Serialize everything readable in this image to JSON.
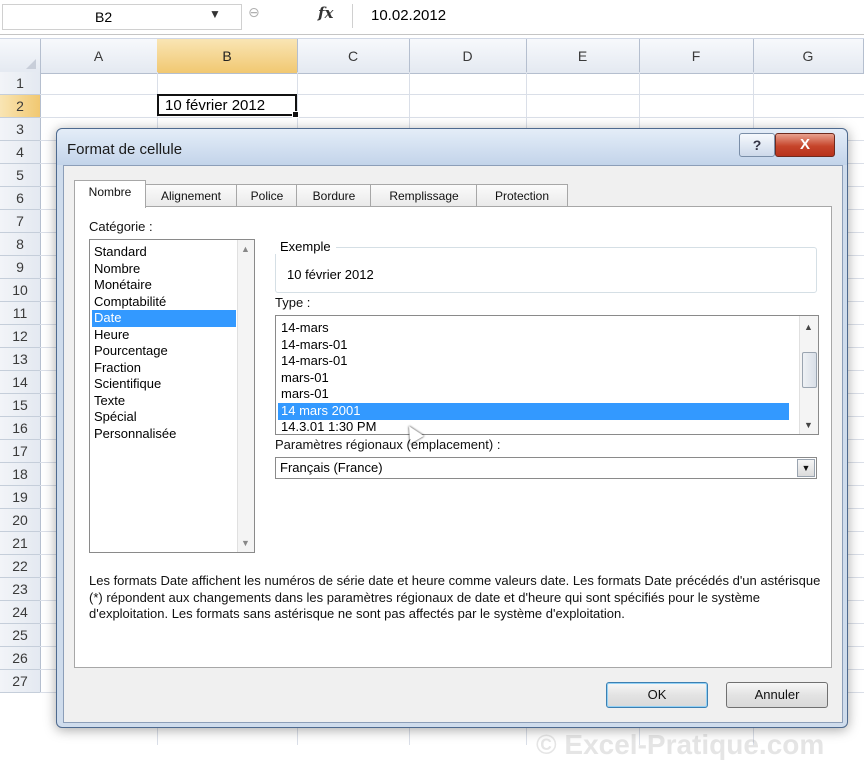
{
  "formula_bar": {
    "name_box": "B2",
    "cancel_glyph": "⊖",
    "fx_label": "fx",
    "formula": "10.02.2012"
  },
  "grid": {
    "columns": [
      "A",
      "B",
      "C",
      "D",
      "E",
      "F",
      "G"
    ],
    "rows": [
      "1",
      "2",
      "3",
      "4",
      "5",
      "6",
      "7",
      "8",
      "9",
      "10",
      "11",
      "12",
      "13",
      "14",
      "15",
      "16",
      "17",
      "18",
      "19",
      "20",
      "21",
      "22",
      "23",
      "24",
      "25",
      "26",
      "27"
    ],
    "selected_column": "B",
    "selected_row": "2",
    "cell_b2": "10 février 2012"
  },
  "dialog": {
    "title": "Format de cellule",
    "help_label": "?",
    "close_label": "X",
    "tabs": [
      "Nombre",
      "Alignement",
      "Police",
      "Bordure",
      "Remplissage",
      "Protection"
    ],
    "active_tab": "Nombre",
    "category_label": "Catégorie :",
    "categories": [
      "Standard",
      "Nombre",
      "Monétaire",
      "Comptabilité",
      "Date",
      "Heure",
      "Pourcentage",
      "Fraction",
      "Scientifique",
      "Texte",
      "Spécial",
      "Personnalisée"
    ],
    "selected_category": "Date",
    "example_label": "Exemple",
    "example_value": "10 février 2012",
    "type_label": "Type :",
    "types": [
      "14-mars",
      "14-mars-01",
      "14-mars-01",
      "mars-01",
      "mars-01",
      "14 mars 2001",
      "14.3.01 1:30 PM"
    ],
    "selected_type": "14 mars 2001",
    "locale_label": "Paramètres régionaux (emplacement) :",
    "locale_value": "Français (France)",
    "description": "Les formats Date affichent les numéros de série date et heure comme valeurs date. Les formats Date précédés d'un astérisque (*) répondent aux changements dans les paramètres régionaux de date et d'heure qui sont spécifiés pour le système d'exploitation. Les formats sans astérisque ne sont pas affectés par le système d'exploitation.",
    "ok_label": "OK",
    "cancel_label": "Annuler"
  },
  "watermark": "© Excel-Pratique.com",
  "colors": {
    "selection": "#3399ff",
    "header_selected": "#f1c871",
    "close_button": "#c6452b"
  }
}
